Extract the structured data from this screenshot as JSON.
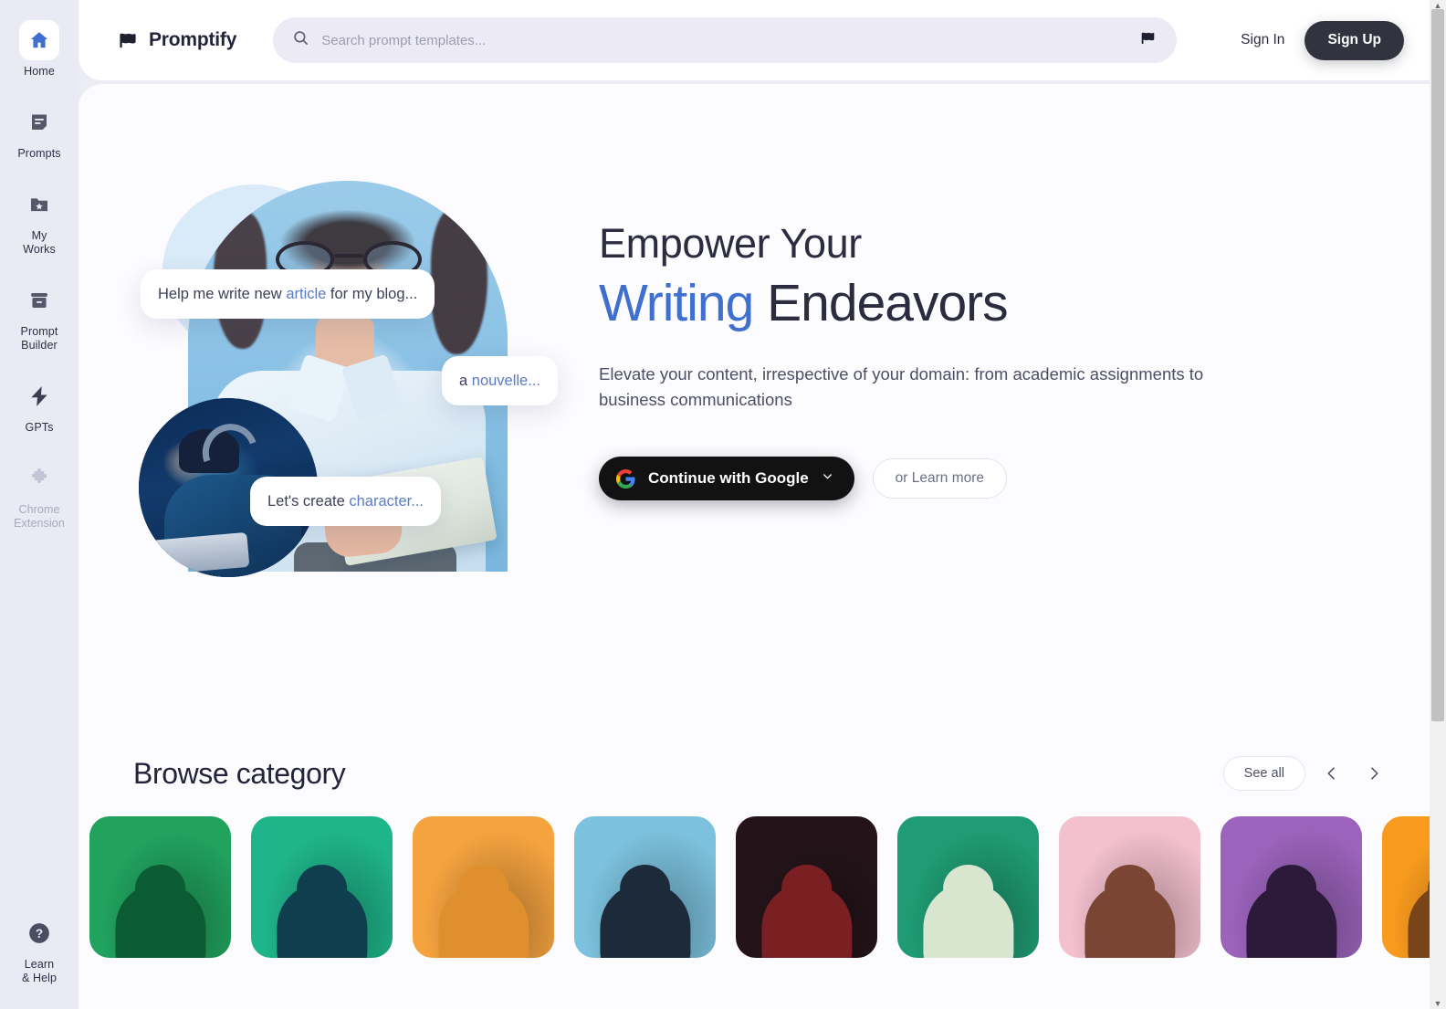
{
  "sidebar": {
    "items": [
      {
        "label": "Home",
        "icon": "home-icon",
        "active": true,
        "muted": false
      },
      {
        "label": "Prompts",
        "icon": "note-icon",
        "active": false,
        "muted": false
      },
      {
        "label": "My\nWorks",
        "icon": "folder-star-icon",
        "active": false,
        "muted": false
      },
      {
        "label": "Prompt\nBuilder",
        "icon": "archive-icon",
        "active": false,
        "muted": false
      },
      {
        "label": "GPTs",
        "icon": "lightning-icon",
        "active": false,
        "muted": false
      },
      {
        "label": "Chrome\nExtension",
        "icon": "puzzle-icon",
        "active": false,
        "muted": true
      }
    ],
    "bottom": {
      "label": "Learn\n& Help",
      "icon": "question-circle-icon"
    }
  },
  "header": {
    "brand": "Promptify",
    "brand_icon": "flag-icon",
    "search": {
      "placeholder": "Search prompt templates...",
      "value": "",
      "icon": "search-icon",
      "trailing_icon": "flag-icon"
    },
    "sign_in": "Sign In",
    "sign_up": "Sign Up"
  },
  "hero": {
    "title_line1": "Empower Your",
    "title_line2_accent": "Writing",
    "title_line2_rest": " Endeavors",
    "subtitle": "Elevate your content, irrespective of your domain: from academic assignments to business communications",
    "google_button": "Continue with Google",
    "google_icon": "google-g-icon",
    "google_chevron": "chevron-down-icon",
    "learn_more": "or Learn more",
    "bubbles": [
      {
        "plain1": "Help me write new ",
        "accent": "article",
        "plain2": " for my blog..."
      },
      {
        "plain1": "a ",
        "accent": "nouvelle...",
        "plain2": ""
      },
      {
        "plain1": "Let's create ",
        "accent": "character...",
        "plain2": ""
      }
    ]
  },
  "browse": {
    "title": "Browse category",
    "see_all": "See all",
    "prev_icon": "chevron-left-icon",
    "next_icon": "chevron-right-icon",
    "cards": [
      {
        "bg": "#21a35e",
        "fig": "#0c5c33"
      },
      {
        "bg": "#1fb58a",
        "fig": "#0f3f4f"
      },
      {
        "bg": "#f5a33f",
        "fig": "#e08f2e"
      },
      {
        "bg": "#7cc1dd",
        "fig": "#1d2a3a"
      },
      {
        "bg": "#241419",
        "fig": "#7a1f22"
      },
      {
        "bg": "#1f9c73",
        "fig": "#d8e6d0"
      },
      {
        "bg": "#f3c0ce",
        "fig": "#7a4633"
      },
      {
        "bg": "#9b63bb",
        "fig": "#2b1a3a"
      },
      {
        "bg": "#f79a1e",
        "fig": "#7a4419"
      }
    ]
  },
  "colors": {
    "accent_blue": "#3f6fcf",
    "ink": "#2b2c3f",
    "sidebar_bg": "#eaeaf4",
    "panel_bg": "#fcfbfe",
    "search_bg": "#ecebf5",
    "signup_bg": "#31333f"
  }
}
